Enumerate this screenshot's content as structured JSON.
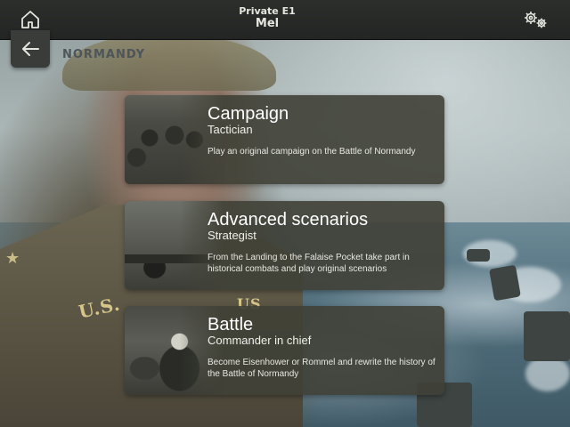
{
  "player": {
    "rank": "Private E1",
    "name": "Mel"
  },
  "section": {
    "title": "NORMANDY"
  },
  "icons": {
    "home": "home-icon",
    "back": "back-arrow-icon",
    "settings": "gears-icon"
  },
  "background": {
    "insignia_left": "U.S.",
    "insignia_right": "US"
  },
  "modes": [
    {
      "title": "Campaign",
      "subtitle": "Tactician",
      "description": "Play an original campaign on the Battle of Normandy"
    },
    {
      "title": "Advanced scenarios",
      "subtitle": "Strategist",
      "description": "From the Landing to the Falaise Pocket take part in historical combats and play original scenarios"
    },
    {
      "title": "Battle",
      "subtitle": "Commander in chief",
      "description": "Become Eisenhower or Rommel and rewrite the history of the Battle of Normandy"
    }
  ],
  "colors": {
    "card": "#3f4036",
    "topbar": "#2c2e2c",
    "section_title": "#4d5559"
  }
}
